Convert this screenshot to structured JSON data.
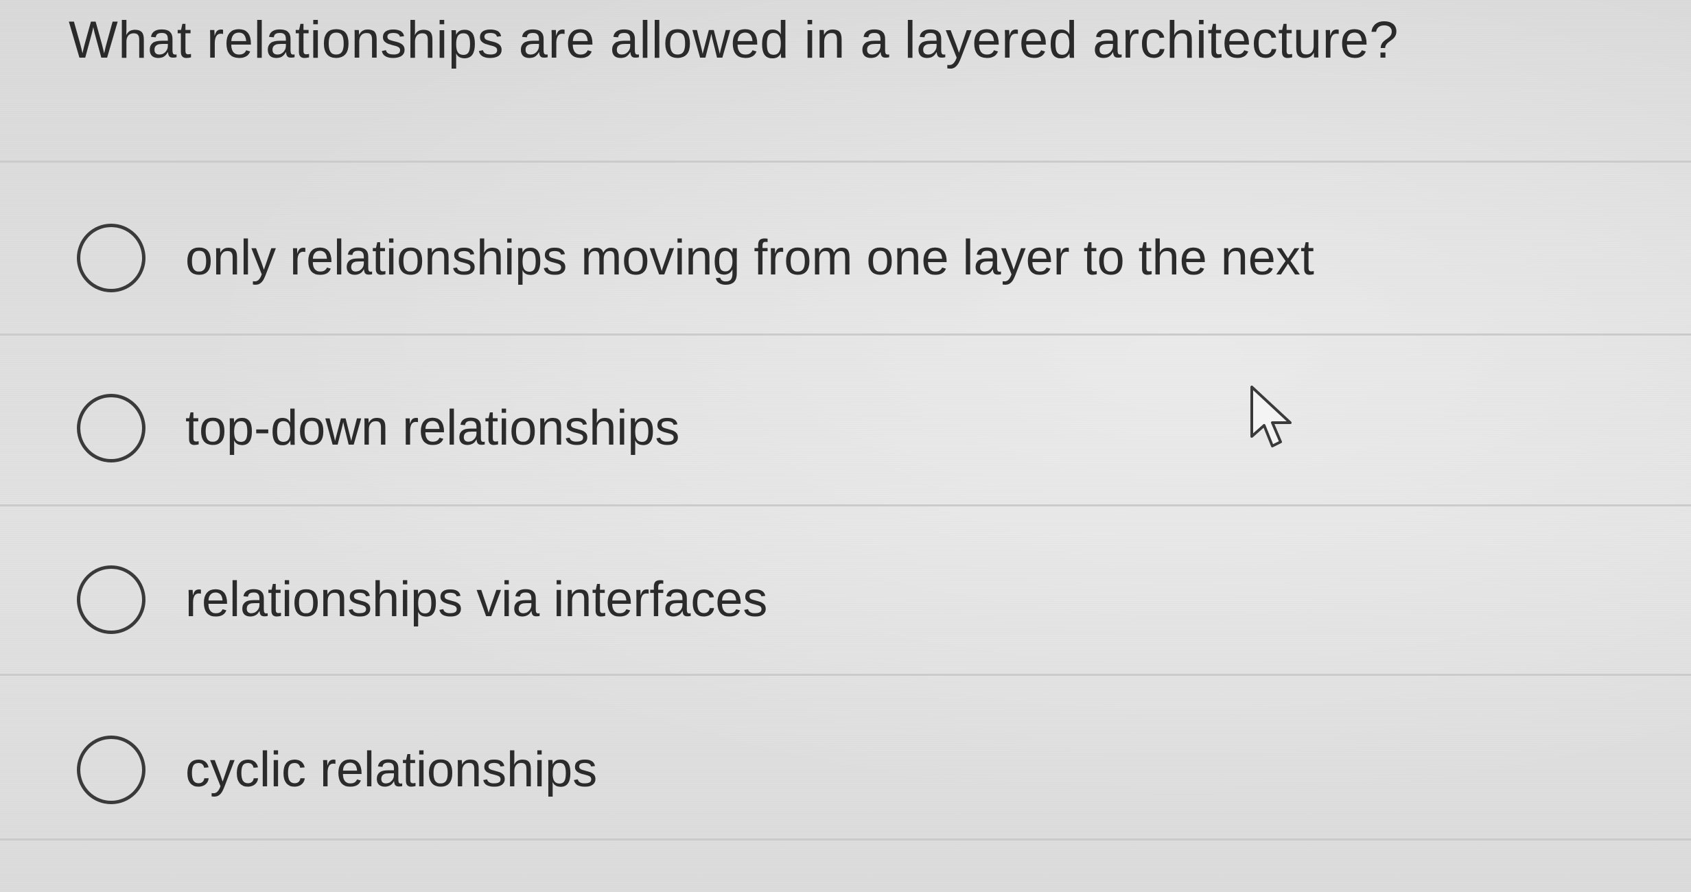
{
  "question": {
    "text": "What relationships are allowed in a layered architecture?"
  },
  "options": [
    {
      "label": "only relationships moving from one layer to the next",
      "selected": false
    },
    {
      "label": "top-down relationships",
      "selected": false
    },
    {
      "label": "relationships via interfaces",
      "selected": false
    },
    {
      "label": "cyclic relationships",
      "selected": false
    }
  ],
  "colors": {
    "background": "#dedede",
    "text": "#2b2b2b",
    "radio_border": "#3a3a3a",
    "divider": "#cbcbcb"
  },
  "cursor": {
    "icon": "mouse-pointer-arrow-icon"
  }
}
